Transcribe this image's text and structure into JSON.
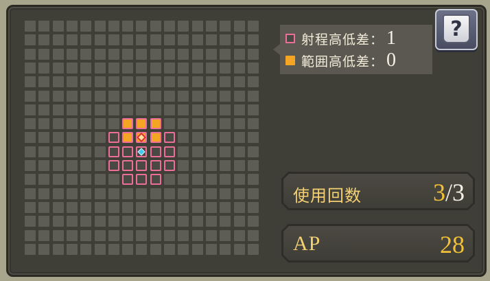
{
  "legend": {
    "range_label": "射程高低差：",
    "range_value": "1",
    "area_label": "範囲高低差：",
    "area_value": "0"
  },
  "help": {
    "glyph": "?"
  },
  "uses": {
    "label": "使用回数",
    "current": "3",
    "separator": "/",
    "max": "3"
  },
  "ap": {
    "label": "AP",
    "value": "28"
  },
  "grid": {
    "size": 17,
    "range_cells": [
      [
        7,
        7
      ],
      [
        8,
        7
      ],
      [
        9,
        7
      ],
      [
        6,
        8
      ],
      [
        7,
        8
      ],
      [
        8,
        8
      ],
      [
        9,
        8
      ],
      [
        10,
        8
      ],
      [
        6,
        9
      ],
      [
        7,
        9
      ],
      [
        8,
        9
      ],
      [
        9,
        9
      ],
      [
        10,
        9
      ],
      [
        6,
        10
      ],
      [
        7,
        10
      ],
      [
        8,
        10
      ],
      [
        9,
        10
      ],
      [
        10,
        10
      ],
      [
        7,
        11
      ],
      [
        8,
        11
      ],
      [
        9,
        11
      ]
    ],
    "area_cells": [
      [
        7,
        7
      ],
      [
        8,
        7
      ],
      [
        9,
        7
      ],
      [
        7,
        8
      ],
      [
        8,
        8
      ],
      [
        9,
        8
      ]
    ],
    "target_cell": [
      8,
      8
    ],
    "origin_cell": [
      8,
      9
    ]
  },
  "colors": {
    "range_border": "#ec6f9a",
    "area_fill": "#f3a523",
    "accent_gold": "#f2c038"
  }
}
